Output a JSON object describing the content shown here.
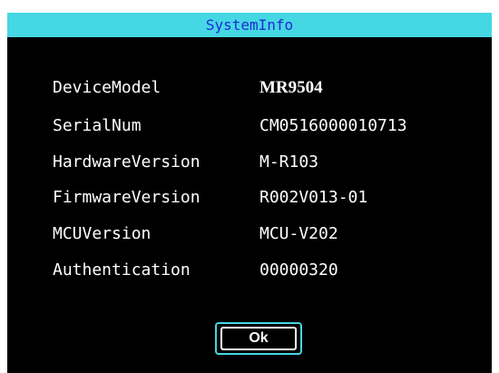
{
  "dialog": {
    "title": "SystemInfo"
  },
  "fields": [
    {
      "label": "DeviceModel",
      "value": "MR9504"
    },
    {
      "label": "SerialNum",
      "value": "CM0516000010713"
    },
    {
      "label": "HardwareVersion",
      "value": "M-R103"
    },
    {
      "label": "FirmwareVersion",
      "value": "R002V013-01"
    },
    {
      "label": "MCUVersion",
      "value": "MCU-V202"
    },
    {
      "label": "Authentication",
      "value": "00000320"
    }
  ],
  "buttons": {
    "ok_label": "Ok"
  },
  "colors": {
    "title_bar": "#45d7e3",
    "title_text": "#1d2bd6",
    "background": "#000000",
    "text": "#ffffff"
  }
}
